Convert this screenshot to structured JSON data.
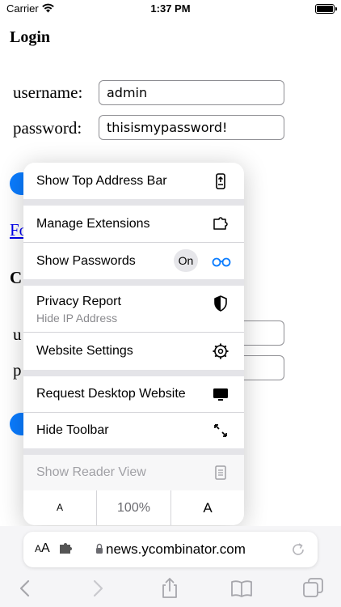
{
  "status_bar": {
    "carrier": "Carrier",
    "time": "1:37 PM"
  },
  "page": {
    "title": "Login",
    "username_label": "username:",
    "username_value": "admin",
    "password_label": "password:",
    "password_value": "thisismypassword!",
    "partial_link": "Fo",
    "partial_heading": "C",
    "partial_u": "u",
    "partial_p": "p"
  },
  "menu": {
    "show_top_address_bar": "Show Top Address Bar",
    "manage_extensions": "Manage Extensions",
    "show_passwords": "Show Passwords",
    "show_passwords_state": "On",
    "privacy_report": "Privacy Report",
    "privacy_report_sub": "Hide IP Address",
    "website_settings": "Website Settings",
    "request_desktop_website": "Request Desktop Website",
    "hide_toolbar": "Hide Toolbar",
    "show_reader_view": "Show Reader View",
    "zoom_decrease": "A",
    "zoom_level": "100%",
    "zoom_increase": "A"
  },
  "address_bar": {
    "aa_small": "A",
    "aa_large": "A",
    "url": "news.ycombinator.com"
  },
  "colors": {
    "link_blue": "#0000ee",
    "accent_blue": "#0a7cff",
    "passwords_icon": "#0a7cff"
  }
}
